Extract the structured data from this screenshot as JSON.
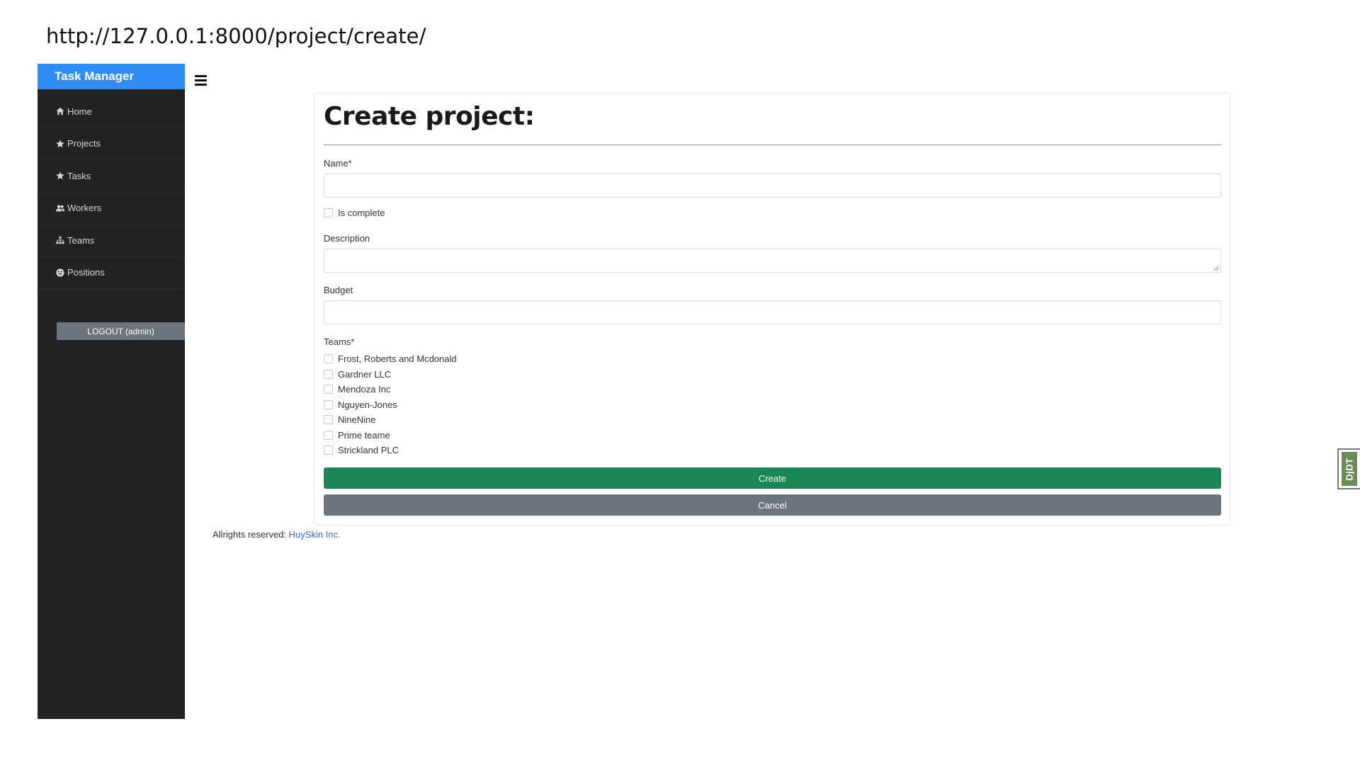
{
  "url_caption": "http://127.0.0.1:8000/project/create/",
  "sidebar": {
    "brand": "Task Manager",
    "items": [
      {
        "label": "Home",
        "icon": "home-icon"
      },
      {
        "label": "Projects",
        "icon": "star-icon"
      },
      {
        "label": "Tasks",
        "icon": "star-icon"
      },
      {
        "label": "Workers",
        "icon": "users-icon"
      },
      {
        "label": "Teams",
        "icon": "sitemap-icon"
      },
      {
        "label": "Positions",
        "icon": "smile-icon"
      }
    ],
    "logout_label": "LOGOUT (admin)"
  },
  "form": {
    "title": "Create project:",
    "name_label": "Name*",
    "name_value": "",
    "is_complete_label": "Is complete",
    "description_label": "Description",
    "description_value": "",
    "budget_label": "Budget",
    "budget_value": "",
    "teams_label": "Teams*",
    "teams": [
      "Frost, Roberts and Mcdonald",
      "Gardner LLC",
      "Mendoza Inc",
      "Nguyen-Jones",
      "NineNine",
      "Prime teame",
      "Strickland PLC"
    ],
    "create_label": "Create",
    "cancel_label": "Cancel"
  },
  "footer": {
    "text": "Allrights reserved: ",
    "link": "HuySkin Inc."
  },
  "debug_toolbar": {
    "label": "DjDT"
  },
  "colors": {
    "brand": "#2f8cf5",
    "sidebar_bg": "#222222",
    "create": "#198754",
    "cancel": "#6c757d",
    "link": "#2f6fd6"
  }
}
